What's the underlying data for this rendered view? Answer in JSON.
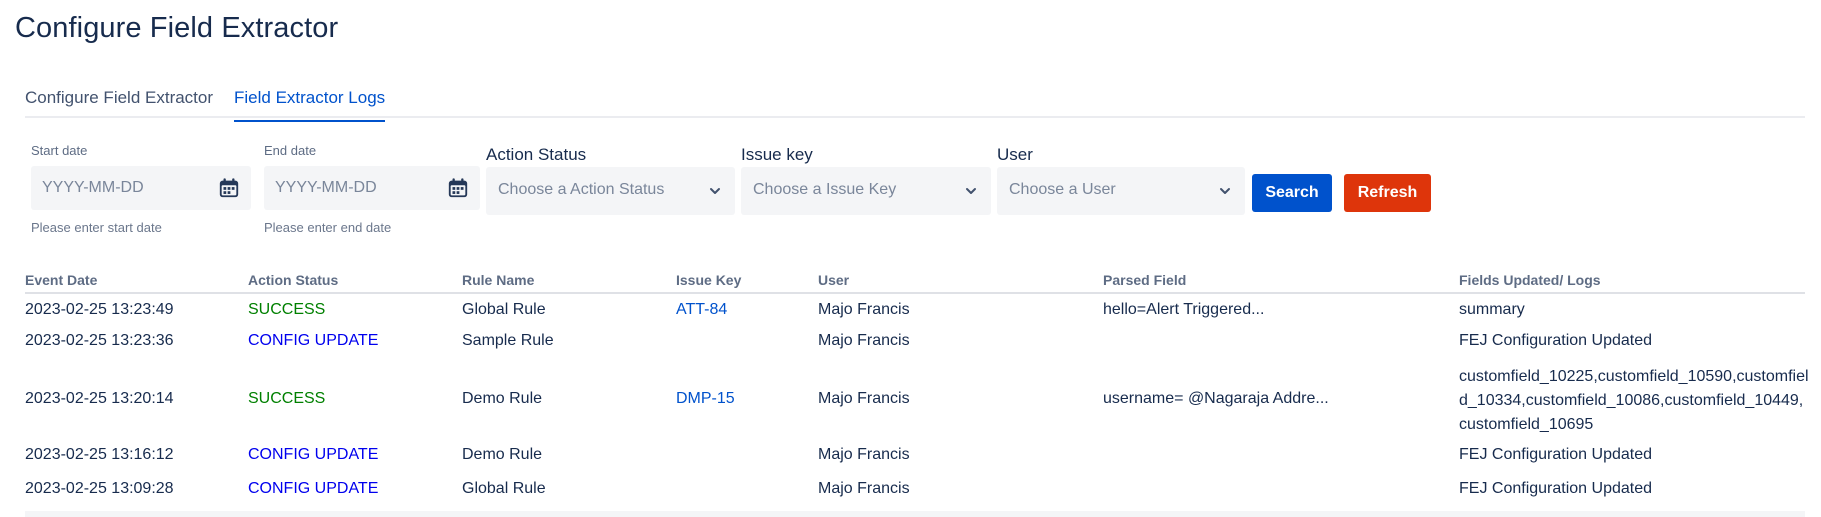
{
  "page": {
    "title": "Configure Field Extractor"
  },
  "tabs": [
    {
      "label": "Configure Field Extractor",
      "active": false
    },
    {
      "label": "Field Extractor Logs",
      "active": true
    }
  ],
  "filters": {
    "start_date": {
      "label": "Start date",
      "placeholder": "YYYY-MM-DD",
      "helper": "Please enter start date"
    },
    "end_date": {
      "label": "End date",
      "placeholder": "YYYY-MM-DD",
      "helper": "Please enter end date"
    },
    "action_status": {
      "label": "Action Status",
      "placeholder": "Choose a Action Status"
    },
    "issue_key": {
      "label": "Issue key",
      "placeholder": "Choose a Issue Key"
    },
    "user": {
      "label": "User",
      "placeholder": "Choose a User"
    },
    "search_label": "Search",
    "refresh_label": "Refresh"
  },
  "table": {
    "headers": [
      "Event Date",
      "Action Status",
      "Rule Name",
      "Issue Key",
      "User",
      "Parsed Field",
      "Fields Updated/ Logs"
    ],
    "rows": [
      {
        "event_date": "2023-02-25 13:23:49",
        "status": "SUCCESS",
        "rule": "Global Rule",
        "issue_key": "ATT-84",
        "user": "Majo Francis",
        "parsed": "hello=Alert Triggered...",
        "logs": "summary"
      },
      {
        "event_date": "2023-02-25 13:23:36",
        "status": "CONFIG UPDATE",
        "rule": "Sample Rule",
        "issue_key": "",
        "user": "Majo Francis",
        "parsed": "",
        "logs": "FEJ Configuration Updated"
      },
      {
        "event_date": "2023-02-25 13:20:14",
        "status": "SUCCESS",
        "rule": "Demo Rule",
        "issue_key": "DMP-15",
        "user": "Majo Francis",
        "parsed": "username= @Nagaraja Addre...",
        "logs": "customfield_10225,customfield_10590,customfield_10334,customfield_10086,customfield_10449,customfield_10695"
      },
      {
        "event_date": "2023-02-25 13:16:12",
        "status": "CONFIG UPDATE",
        "rule": "Demo Rule",
        "issue_key": "",
        "user": "Majo Francis",
        "parsed": "",
        "logs": "FEJ Configuration Updated"
      },
      {
        "event_date": "2023-02-25 13:09:28",
        "status": "CONFIG UPDATE",
        "rule": "Global Rule",
        "issue_key": "",
        "user": "Majo Francis",
        "parsed": "",
        "logs": "FEJ Configuration Updated"
      }
    ]
  },
  "colors": {
    "primary": "#0052cc",
    "danger": "#de350b",
    "success": "#008000",
    "config": "#0000ee"
  },
  "icons": {
    "date": "calendar-icon",
    "select": "chevron-down-icon"
  }
}
